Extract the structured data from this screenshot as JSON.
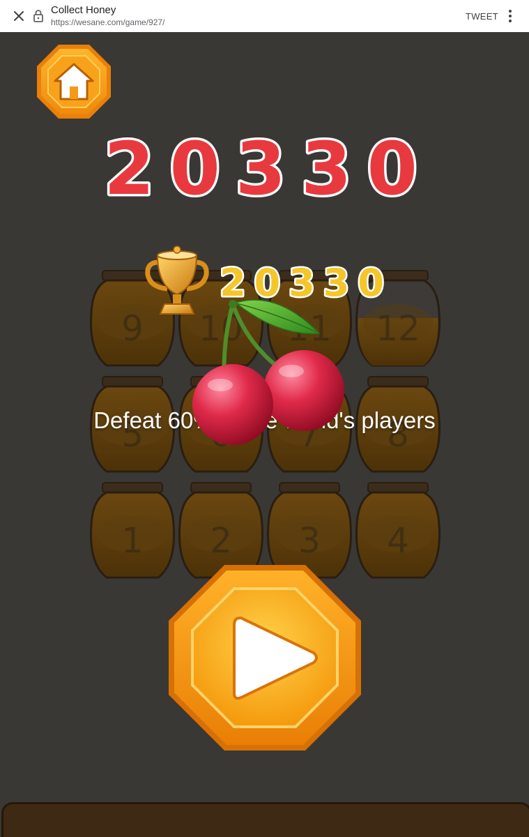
{
  "browser": {
    "title": "Collect Honey",
    "url": "https://wesane.com/game/927/",
    "tweet_label": "TWEET",
    "close_icon": "close-icon",
    "lock_icon": "lock-icon",
    "menu_icon": "more-vert-icon"
  },
  "game": {
    "score": "20330",
    "best_score": "20330",
    "defeat_text": "Defeat 60% of the world's players",
    "jar_numbers": [
      "9",
      "10",
      "11",
      "12",
      "5",
      "6",
      "7",
      "8",
      "1",
      "2",
      "3",
      "4"
    ],
    "colors": {
      "background": "#3a3835",
      "score_red": "#e8393f",
      "best_yellow": "#f5c62a",
      "button_orange": "#f29a12"
    },
    "icons": [
      "home-icon",
      "trophy-icon",
      "cherry-icon",
      "play-icon"
    ]
  }
}
